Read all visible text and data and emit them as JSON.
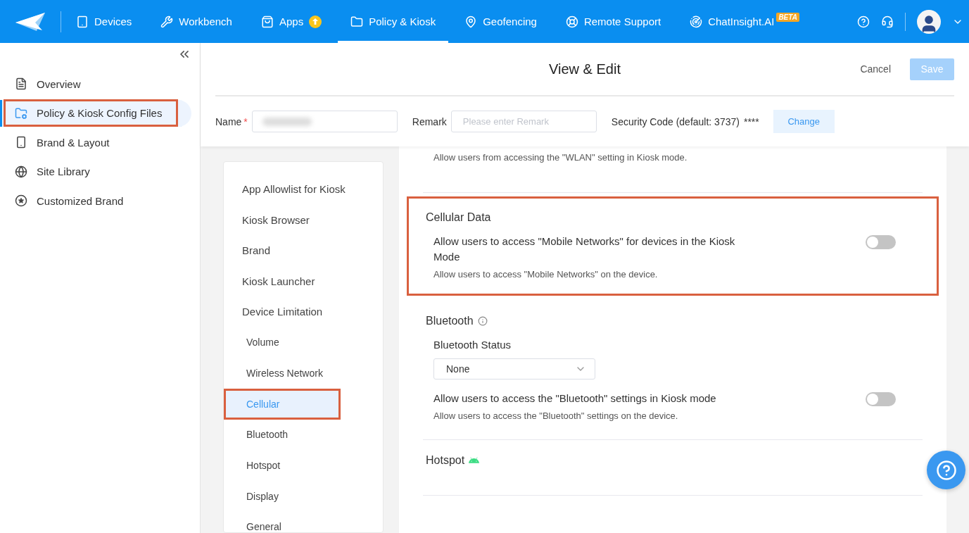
{
  "nav": {
    "items": [
      {
        "label": "Devices",
        "selected": false,
        "update_available": false
      },
      {
        "label": "Workbench",
        "selected": false,
        "update_available": false
      },
      {
        "label": "Apps",
        "selected": false,
        "update_available": true
      },
      {
        "label": "Policy & Kiosk",
        "selected": true,
        "update_available": false
      },
      {
        "label": "Geofencing",
        "selected": false,
        "update_available": false
      },
      {
        "label": "Remote Support",
        "selected": false,
        "update_available": false
      },
      {
        "label": "ChatInsight.AI",
        "selected": false,
        "update_available": false,
        "badge": "BETA"
      }
    ]
  },
  "sidebar": {
    "items": [
      {
        "label": "Overview",
        "selected": false,
        "annotated": false
      },
      {
        "label": "Policy & Kiosk Config Files",
        "selected": true,
        "annotated": true
      },
      {
        "label": "Brand & Layout",
        "selected": false,
        "annotated": false
      },
      {
        "label": "Site Library",
        "selected": false,
        "annotated": false
      },
      {
        "label": "Customized Brand",
        "selected": false,
        "annotated": false
      }
    ]
  },
  "header": {
    "title": "View & Edit",
    "cancel": "Cancel",
    "save": "Save",
    "save_disabled": true
  },
  "form": {
    "name_label": "Name",
    "name_required": true,
    "required_mark": "*",
    "remark_label": "Remark",
    "remark_placeholder": "Please enter Remark",
    "security_label": "Security Code (default: 3737)",
    "security_mask": "****",
    "change_button": "Change"
  },
  "subnav": {
    "items": [
      {
        "label": "App Allowlist for Kiosk",
        "selected": false,
        "annotated": false
      },
      {
        "label": "Kiosk Browser",
        "selected": false,
        "annotated": false
      },
      {
        "label": "Brand",
        "selected": false,
        "annotated": false
      },
      {
        "label": "Kiosk Launcher",
        "selected": false,
        "annotated": false
      },
      {
        "label": "Device Limitation",
        "selected": false,
        "annotated": false,
        "children": [
          {
            "label": "Volume",
            "selected": false,
            "annotated": false
          },
          {
            "label": "Wireless Network",
            "selected": false,
            "annotated": false
          },
          {
            "label": "Cellular",
            "selected": true,
            "annotated": true
          },
          {
            "label": "Bluetooth",
            "selected": false,
            "annotated": false
          },
          {
            "label": "Hotspot",
            "selected": false,
            "annotated": false
          },
          {
            "label": "Display",
            "selected": false,
            "annotated": false
          },
          {
            "label": "General",
            "selected": false,
            "annotated": false
          }
        ]
      }
    ]
  },
  "sections": [
    {
      "annotated": false,
      "rows": [
        {
          "kind": "note",
          "description": "Allow users from accessing the \"WLAN\" setting in Kiosk mode."
        }
      ]
    },
    {
      "title": "Cellular Data",
      "annotated": true,
      "info": false,
      "android": false,
      "rows": [
        {
          "kind": "toggle",
          "label": "Allow users to access \"Mobile Networks\" for devices in the Kiosk Mode",
          "description": "Allow users to access \"Mobile Networks\" on the device.",
          "on": false
        }
      ]
    },
    {
      "title": "Bluetooth",
      "annotated": false,
      "info": true,
      "android": false,
      "rows": [
        {
          "kind": "select",
          "label": "Bluetooth Status",
          "value": "None"
        },
        {
          "kind": "toggle",
          "label": "Allow users to access the \"Bluetooth\" settings in Kiosk mode",
          "description": "Allow users to access the \"Bluetooth\" settings on the device.",
          "on": false
        }
      ]
    },
    {
      "title": "Hotspot",
      "annotated": false,
      "info": false,
      "android": true
    }
  ]
}
